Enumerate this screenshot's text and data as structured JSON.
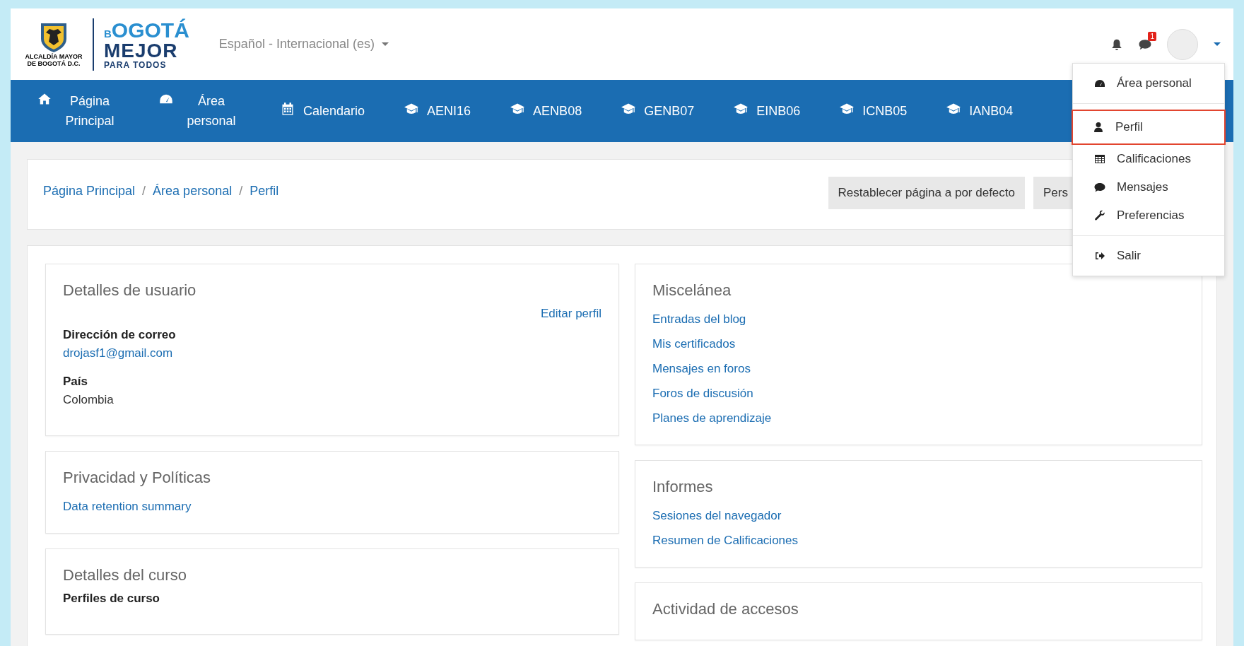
{
  "header": {
    "logo": {
      "crest_caption": [
        "ALCALDÍA MAYOR",
        "DE BOGOTÁ D.C."
      ],
      "title_small": "B",
      "title_main": "OGOTÁ",
      "title_line2": "MEJOR",
      "title_line3": "PARA TODOS"
    },
    "language": "Español - Internacional (es)",
    "message_badge": "1"
  },
  "nav": [
    {
      "kind": "home",
      "label": "Página Principal"
    },
    {
      "kind": "dashboard",
      "label": "Área personal"
    },
    {
      "kind": "calendar",
      "label": "Calendario"
    },
    {
      "kind": "course",
      "label": "AENI16"
    },
    {
      "kind": "course",
      "label": "AENB08"
    },
    {
      "kind": "course",
      "label": "GENB07"
    },
    {
      "kind": "course",
      "label": "EINB06"
    },
    {
      "kind": "course",
      "label": "ICNB05"
    },
    {
      "kind": "course",
      "label": "IANB04"
    }
  ],
  "user_menu": [
    [
      {
        "kind": "dashboard",
        "label": "Área personal",
        "selected": false
      }
    ],
    [
      {
        "kind": "user",
        "label": "Perfil",
        "selected": true
      },
      {
        "kind": "table",
        "label": "Calificaciones",
        "selected": false
      },
      {
        "kind": "chat",
        "label": "Mensajes",
        "selected": false
      },
      {
        "kind": "wrench",
        "label": "Preferencias",
        "selected": false
      }
    ],
    [
      {
        "kind": "signout",
        "label": "Salir",
        "selected": false
      }
    ]
  ],
  "breadcrumb": [
    {
      "kind": "link",
      "text": "Página Principal"
    },
    {
      "kind": "separator",
      "text": "/"
    },
    {
      "kind": "link",
      "text": "Área personal"
    },
    {
      "kind": "separator",
      "text": "/"
    },
    {
      "kind": "link",
      "text": "Perfil"
    }
  ],
  "page_buttons": [
    "Restablecer página a por defecto",
    "Pers"
  ],
  "columns": [
    [
      {
        "title": "Detalles de usuario",
        "action": "Editar perfil",
        "fields": [
          {
            "label": "Dirección de correo",
            "value": "drojasf1@gmail.com",
            "kind": "link"
          },
          {
            "label": "País",
            "value": "Colombia",
            "kind": "text"
          }
        ]
      },
      {
        "title": "Privacidad y Políticas",
        "links": [
          "Data retention summary"
        ]
      },
      {
        "title": "Detalles del curso",
        "fields": [
          {
            "label": "Perfiles de curso"
          }
        ]
      }
    ],
    [
      {
        "title": "Miscelánea",
        "links": [
          "Entradas del blog",
          "Mis certificados",
          "Mensajes en foros",
          "Foros de discusión",
          "Planes de aprendizaje"
        ]
      },
      {
        "title": "Informes",
        "links": [
          "Sesiones del navegador",
          "Resumen de Calificaciones"
        ]
      },
      {
        "title": "Actividad de accesos"
      }
    ]
  ]
}
